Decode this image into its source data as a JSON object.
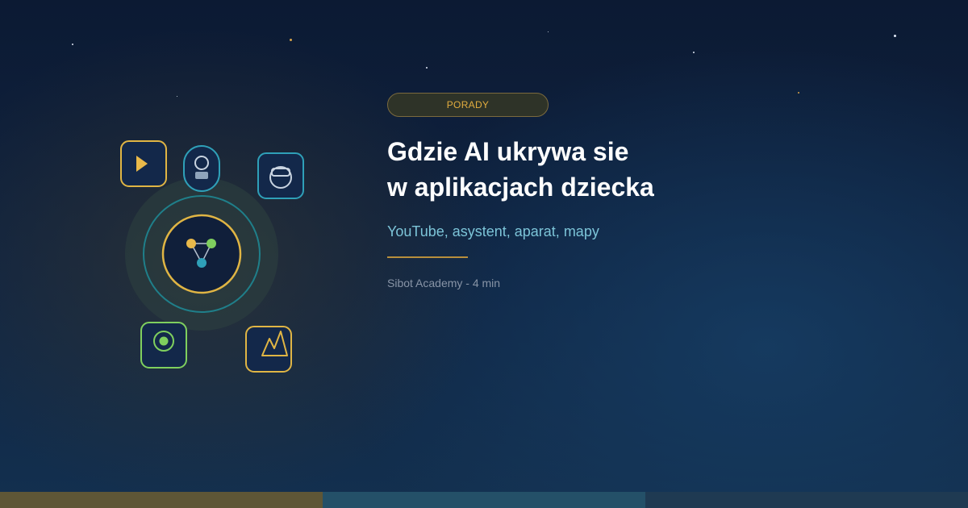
{
  "badge": {
    "label": "PORADY"
  },
  "headline": {
    "line1": "Gdzie AI ukrywa sie",
    "line2": "w aplikacjach dziecka"
  },
  "subtitle": "YouTube, asystent, aparat, mapy",
  "meta": "Sibot Academy - 4 min",
  "colors": {
    "background": "#0f2442",
    "accent_gold": "#e2ad3f",
    "accent_teal": "#2fa0b8",
    "accent_green": "#7fcf5e",
    "subtitle": "#7cc4d8",
    "bottom_bar": [
      "#5e5636",
      "#245068",
      "#1f3a52"
    ]
  },
  "icons": [
    "play-icon",
    "avatar-icon",
    "robot-icon",
    "network-icon",
    "location-icon",
    "map-icon"
  ]
}
